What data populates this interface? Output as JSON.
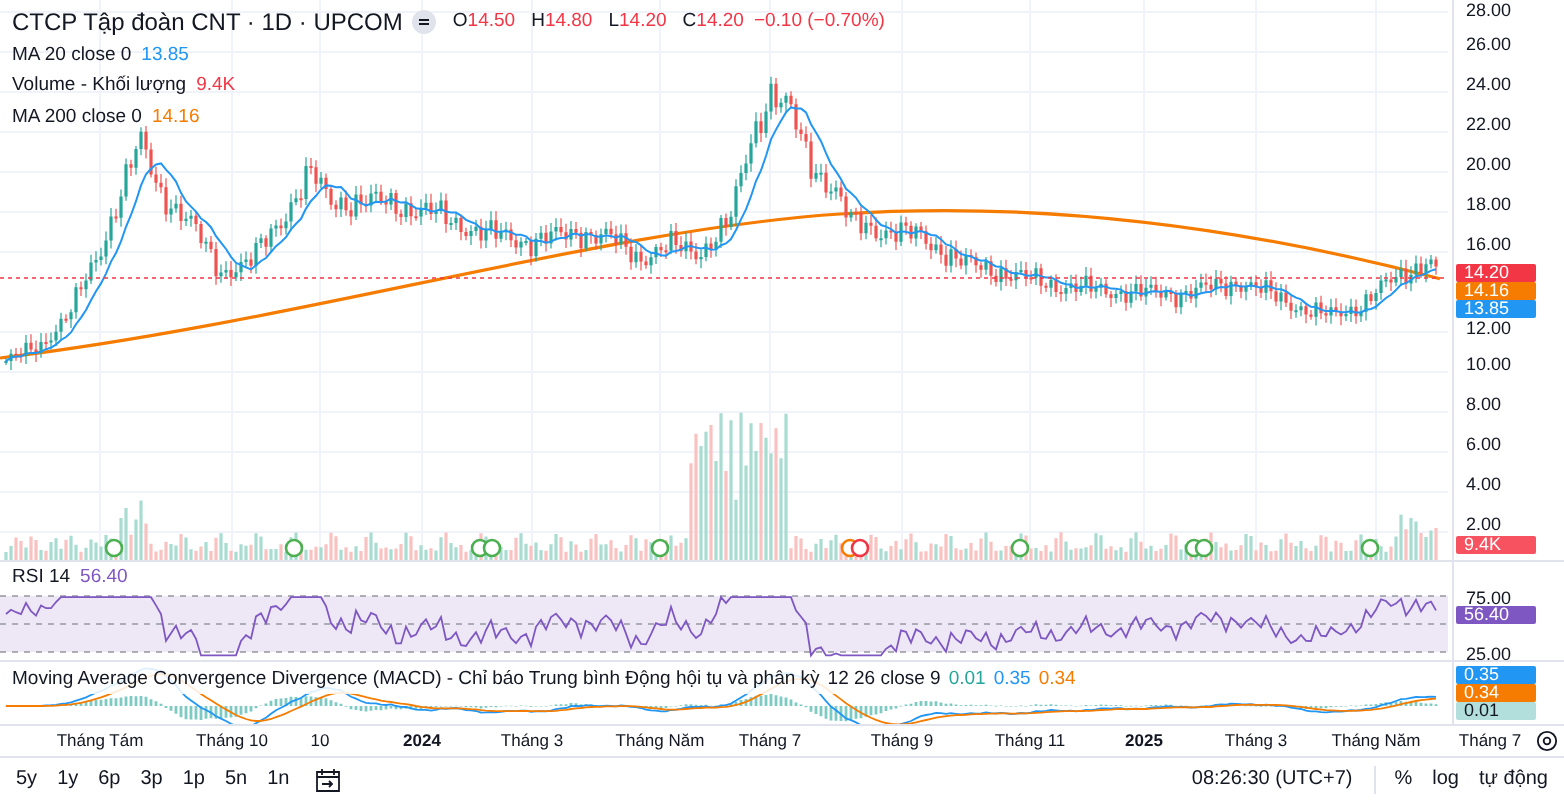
{
  "header": {
    "symbol": "CTCP Tập đoàn CNT · 1D · UPCOM",
    "ohlc": [
      {
        "label": "O",
        "value": "14.50"
      },
      {
        "label": "H",
        "value": "14.80"
      },
      {
        "label": "L",
        "value": "14.20"
      },
      {
        "label": "C",
        "value": "14.20"
      }
    ],
    "change": "−0.10 (−0.70%)"
  },
  "indicators": [
    {
      "name": "MA 20 close 0",
      "value": "13.85",
      "color": "#2196f3"
    },
    {
      "name": "Volume - Khối lượng",
      "value": "9.4K",
      "color": "#f23645"
    },
    {
      "name": "MA 200 close 0",
      "value": "14.16",
      "color": "#f57c00"
    }
  ],
  "price_axis": {
    "ticks": [
      "28.00",
      "26.00",
      "24.00",
      "22.00",
      "20.00",
      "18.00",
      "16.00",
      "12.00",
      "10.00",
      "8.00",
      "6.00",
      "4.00",
      "2.00"
    ],
    "markers": [
      {
        "value": "14.20",
        "color": "#f23645"
      },
      {
        "value": "14.16",
        "color": "#f57c00"
      },
      {
        "value": "13.85",
        "color": "#2196f3"
      }
    ],
    "volume_marker": {
      "value": "9.4K",
      "color": "#f7525f"
    }
  },
  "events": [
    {
      "color": "#4caf50"
    },
    {
      "color": "#4caf50"
    },
    {
      "color": "#4caf50"
    },
    {
      "color": "#4caf50"
    },
    {
      "color": "#4caf50"
    },
    {
      "color": "#f57c00"
    },
    {
      "color": "#f23645"
    },
    {
      "color": "#4caf50"
    },
    {
      "color": "#4caf50"
    },
    {
      "color": "#4caf50"
    },
    {
      "color": "#4caf50"
    }
  ],
  "rsi": {
    "name": "RSI 14",
    "value": "56.40",
    "color": "#7e57c2",
    "ticks": [
      "75.00",
      "25.00"
    ],
    "axis_marker": "56.40"
  },
  "macd": {
    "name": "Moving Average Convergence Divergence (MACD) - Chỉ báo Trung bình Động hội tụ và phân kỳ",
    "params": "12 26 close 9",
    "values": [
      {
        "value": "0.01",
        "color": "#26a69a"
      },
      {
        "value": "0.35",
        "color": "#2196f3"
      },
      {
        "value": "0.34",
        "color": "#f57c00"
      }
    ],
    "markers": [
      {
        "value": "0.35",
        "color": "#2196f3"
      },
      {
        "value": "0.34",
        "color": "#f57c00"
      },
      {
        "value": "0.01",
        "color": "#b2dfdb"
      }
    ]
  },
  "time_axis": [
    {
      "label": "Tháng Tám",
      "kind": "month"
    },
    {
      "label": "Tháng 10",
      "kind": "month"
    },
    {
      "label": "10",
      "kind": "month"
    },
    {
      "label": "2024",
      "kind": "year"
    },
    {
      "label": "Tháng 3",
      "kind": "month"
    },
    {
      "label": "Tháng Năm",
      "kind": "month"
    },
    {
      "label": "Tháng 7",
      "kind": "month"
    },
    {
      "label": "Tháng 9",
      "kind": "month"
    },
    {
      "label": "Tháng 11",
      "kind": "month"
    },
    {
      "label": "2025",
      "kind": "year"
    },
    {
      "label": "Tháng 3",
      "kind": "month"
    },
    {
      "label": "Tháng Năm",
      "kind": "month"
    },
    {
      "label": "Tháng 7",
      "kind": "month"
    }
  ],
  "ranges": [
    "5y",
    "1y",
    "6p",
    "3p",
    "1p",
    "5n",
    "1n"
  ],
  "clock": "08:26:30 (UTC+7)",
  "scale_options": [
    "%",
    "log",
    "tự động"
  ]
}
